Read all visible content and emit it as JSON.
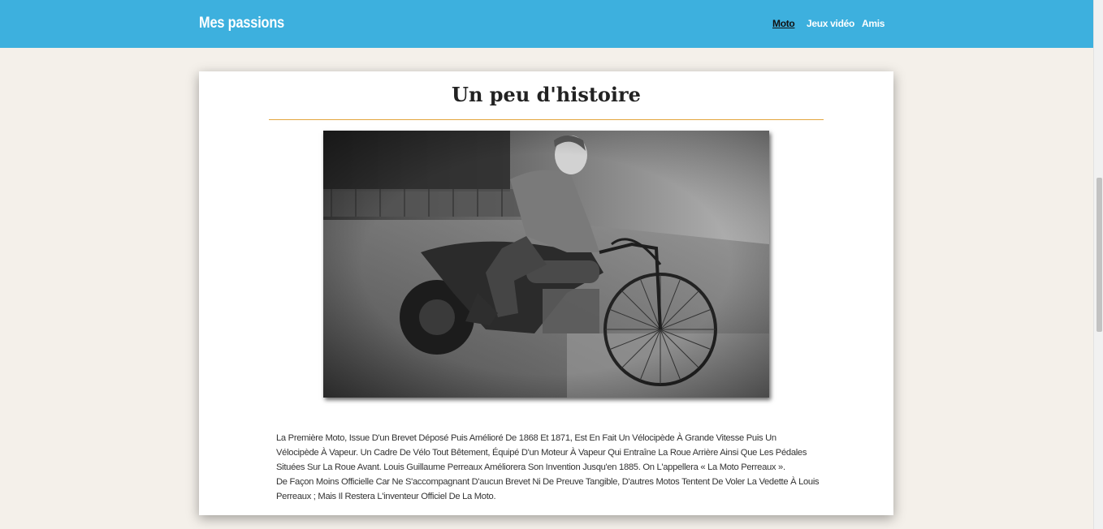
{
  "header": {
    "brand": "Mes passions",
    "nav": [
      {
        "label": "Moto",
        "active": true
      },
      {
        "label": "Jeux vidéo",
        "active": false
      },
      {
        "label": "Amis",
        "active": false
      }
    ],
    "background_color": "#3db0de"
  },
  "article": {
    "title": "Un peu d'histoire",
    "image": "vintage-motorcycle-photo",
    "paragraphs": [
      "La Première Moto, Issue D'un Brevet Déposé Puis Amélioré De 1868 Et 1871, Est En Fait Un Vélocipède À Grande Vitesse Puis Un Vélocipède À Vapeur. Un Cadre De Vélo Tout Bêtement, Équipé D'un Moteur À Vapeur Qui Entraîne La Roue Arrière Ainsi Que Les Pédales Situées Sur La Roue Avant. Louis Guillaume Perreaux Améliorera Son Invention Jusqu'en 1885. On L'appellera « La Moto Perreaux ».",
      "De Façon Moins Officielle Car Ne S'accompagnant D'aucun Brevet Ni De Preuve Tangible, D'autres Motos Tentent De Voler La Vedette À Louis Perreaux ; Mais Il Restera L'inventeur Officiel De La Moto."
    ],
    "divider_color": "#e3a63d"
  }
}
